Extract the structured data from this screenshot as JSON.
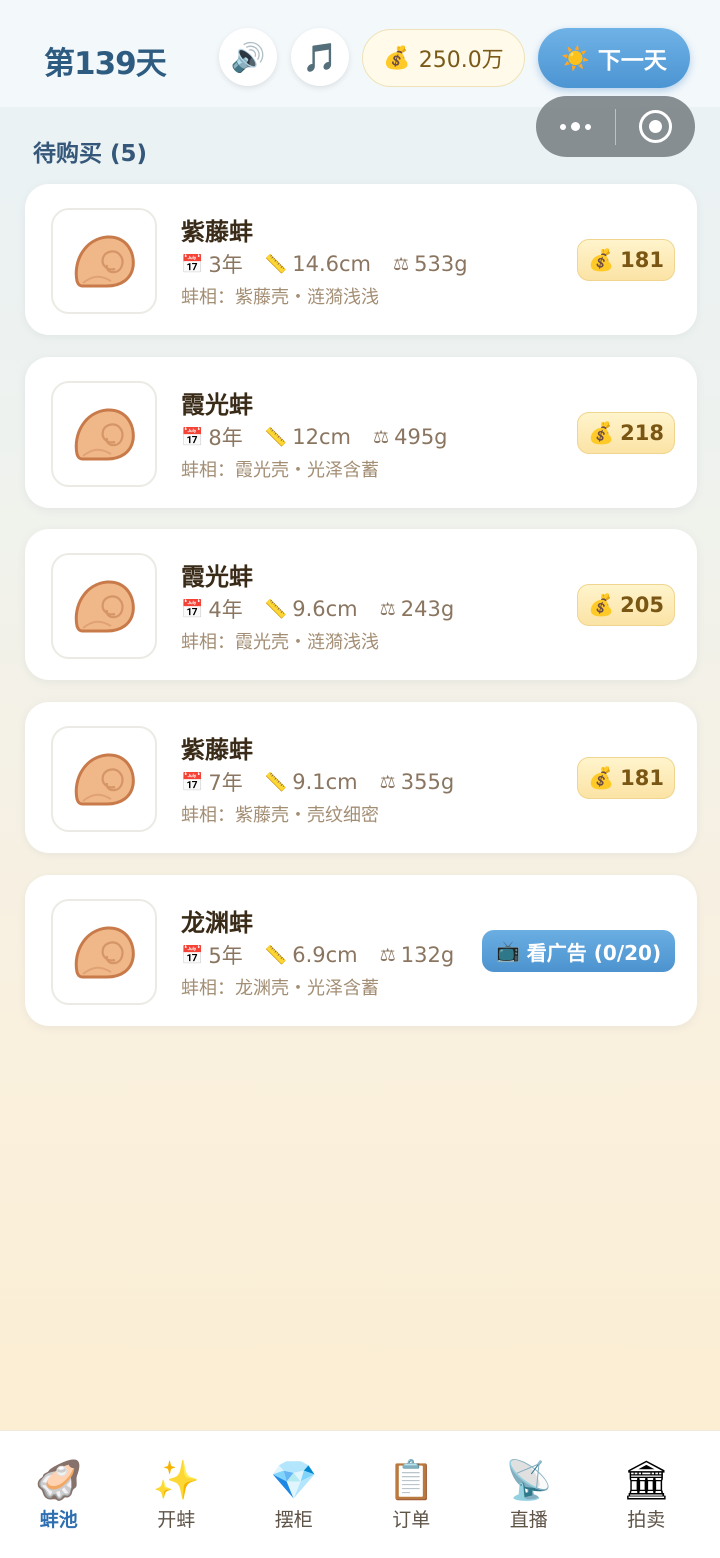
{
  "header": {
    "day_label": "第139天",
    "sound_icon": "🔊",
    "music_icon": "🎵",
    "coins_icon": "💰",
    "coins": "250.0万",
    "next_day_icon": "☀️",
    "next_day_label": "下一天"
  },
  "section": {
    "title": "待购买 (5)"
  },
  "colors": {
    "accent": "#4c95d3",
    "title": "#2e5b80",
    "price_bg": "#fbe3a5"
  },
  "icons": {
    "calendar": "📅",
    "ruler": "📏",
    "scale": "⚖",
    "money": "💰",
    "tv": "📺"
  },
  "items": [
    {
      "name": "紫藤蚌",
      "age": "3年",
      "length": "14.6cm",
      "weight": "533g",
      "traits": "蚌相：紫藤壳・涟漪浅浅",
      "price": "181",
      "action": "price"
    },
    {
      "name": "霞光蚌",
      "age": "8年",
      "length": "12cm",
      "weight": "495g",
      "traits": "蚌相：霞光壳・光泽含蓄",
      "price": "218",
      "action": "price"
    },
    {
      "name": "霞光蚌",
      "age": "4年",
      "length": "9.6cm",
      "weight": "243g",
      "traits": "蚌相：霞光壳・涟漪浅浅",
      "price": "205",
      "action": "price"
    },
    {
      "name": "紫藤蚌",
      "age": "7年",
      "length": "9.1cm",
      "weight": "355g",
      "traits": "蚌相：紫藤壳・壳纹细密",
      "price": "181",
      "action": "price"
    },
    {
      "name": "龙渊蚌",
      "age": "5年",
      "length": "6.9cm",
      "weight": "132g",
      "traits": "蚌相：龙渊壳・光泽含蓄",
      "ad_label": "看广告 (0/20)",
      "action": "ad"
    }
  ],
  "tabs": [
    {
      "icon": "🦪",
      "label": "蚌池",
      "active": true
    },
    {
      "icon": "✨",
      "label": "开蚌",
      "active": false
    },
    {
      "icon": "💎",
      "label": "摆柜",
      "active": false
    },
    {
      "icon": "📋",
      "label": "订单",
      "active": false
    },
    {
      "icon": "📡",
      "label": "直播",
      "active": false
    },
    {
      "icon": "🏛",
      "label": "拍卖",
      "active": false
    }
  ]
}
